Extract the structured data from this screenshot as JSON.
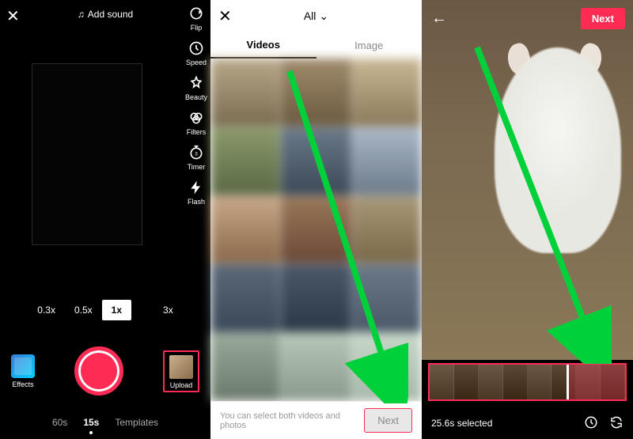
{
  "screen1": {
    "addSound": "Add sound",
    "tools": {
      "flip": "Flip",
      "speed": "Speed",
      "beauty": "Beauty",
      "filters": "Filters",
      "timer": "Timer",
      "flash": "Flash"
    },
    "zoom": [
      "0.3x",
      "0.5x",
      "1x",
      "",
      "3x"
    ],
    "zoomActive": "1x",
    "effects": "Effects",
    "upload": "Upload",
    "modes": [
      "60s",
      "15s",
      "Templates"
    ],
    "modeActive": "15s"
  },
  "screen2": {
    "allLabel": "All",
    "tabs": {
      "videos": "Videos",
      "image": "Image"
    },
    "hint": "You can select both videos and photos",
    "next": "Next"
  },
  "screen3": {
    "next": "Next",
    "selected": "25.6s selected"
  },
  "colors": {
    "accent": "#fe2c55",
    "arrow": "#00d13a"
  }
}
